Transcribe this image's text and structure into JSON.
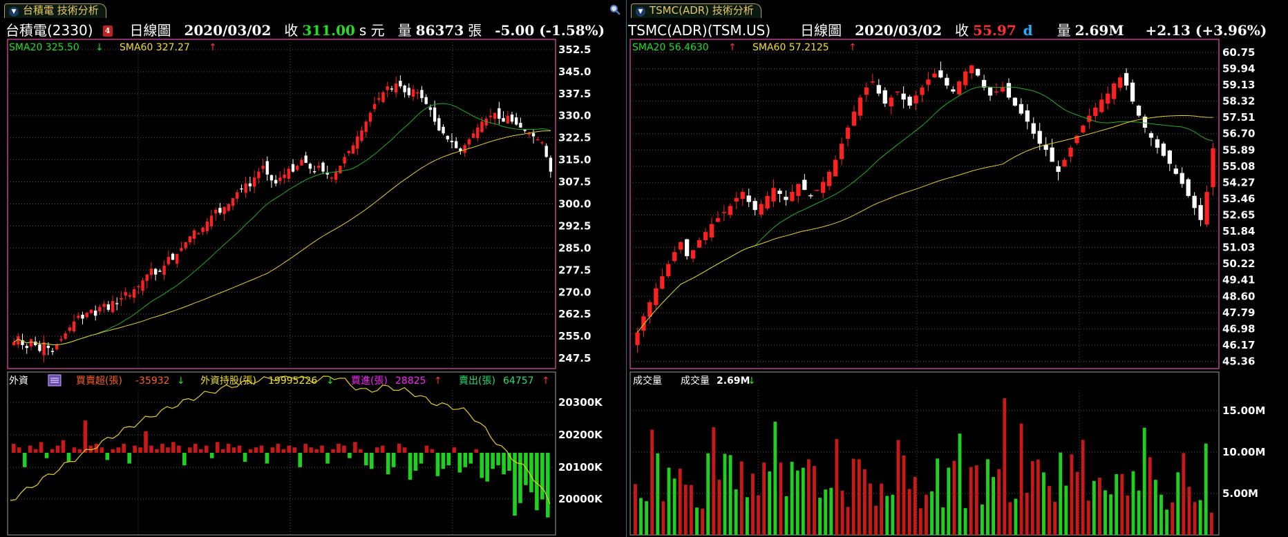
{
  "left": {
    "tab_label": "台積電 技術分析",
    "header": {
      "name": "台積電(2330)",
      "badge": "4",
      "period": "日線圖",
      "date": "2020/03/02",
      "close_label": "收",
      "close_value": "311.00",
      "close_unit": "s 元",
      "volume_label": "量",
      "volume_value": "86373",
      "volume_unit": "張",
      "change": "-5.00 (-1.58%)"
    },
    "legend": {
      "sma20": "SMA20 325.50",
      "sma20_dir": "↓",
      "sma60": "SMA60 327.27",
      "sma60_dir": "↑"
    },
    "y_ticks": [
      "352.5",
      "345.0",
      "337.5",
      "330.0",
      "322.5",
      "315.0",
      "307.5",
      "300.0",
      "292.5",
      "285.0",
      "277.5",
      "270.0",
      "262.5",
      "255.0",
      "247.5"
    ],
    "sub": {
      "title": "外資",
      "net_label": "買賣超(張)",
      "net_value": "-35932",
      "net_dir": "↓",
      "holding_label": "外資持股(張)",
      "holding_value": "19995226",
      "holding_dir": "↓",
      "buy_label": "買進(張)",
      "buy_value": "28825",
      "buy_dir": "↑",
      "sell_label": "賣出(張)",
      "sell_value": "64757",
      "sell_dir": "↑",
      "y_ticks": [
        "20300K",
        "20200K",
        "20100K",
        "20000K"
      ]
    }
  },
  "right": {
    "tab_label": "TSMC(ADR) 技術分析",
    "header": {
      "name": "TSMC(ADR)(TSM.US)",
      "period": "日線圖",
      "date": "2020/03/02",
      "close_label": "收",
      "close_value": "55.97",
      "close_unit": "d",
      "volume_label": "量",
      "volume_value": "2.69M",
      "change": "+2.13 (+3.96%)"
    },
    "legend": {
      "sma20": "SMA20 56.4630",
      "sma20_dir": "↑",
      "sma60": "SMA60 57.2125",
      "sma60_dir": "↑"
    },
    "y_ticks": [
      "60.75",
      "59.94",
      "59.13",
      "58.32",
      "57.51",
      "56.70",
      "55.89",
      "55.08",
      "54.27",
      "53.46",
      "52.65",
      "51.84",
      "51.03",
      "50.22",
      "49.41",
      "48.60",
      "47.79",
      "46.98",
      "46.17",
      "45.36"
    ],
    "sub": {
      "title": "成交量",
      "vol_label": "成交量",
      "vol_value": "2.69M",
      "vol_dir": "↓",
      "y_ticks": [
        "15.00M",
        "10.00M",
        "5.00M"
      ]
    }
  },
  "colors": {
    "up": "#ff2020",
    "down": "#ffffff",
    "vol_up": "#c81818",
    "vol_down": "#20d020",
    "sma20": "#20b020",
    "sma60": "#e8d020",
    "grid": "#555555",
    "frame_main": "#c0408a",
    "frame_sub": "#a0a0a0"
  },
  "chart_data": [
    {
      "type": "candlestick",
      "title": "台積電(2330) 日線圖",
      "ylim": [
        244,
        356
      ],
      "y_ticks": [
        352.5,
        345.0,
        337.5,
        330.0,
        322.5,
        315.0,
        307.5,
        300.0,
        292.5,
        285.0,
        277.5,
        270.0,
        262.5,
        255.0,
        247.5
      ],
      "start_price": 252,
      "closes": [
        253,
        255,
        252,
        251,
        254,
        252,
        250,
        253,
        251,
        250,
        252,
        254,
        256,
        258,
        260,
        262,
        261,
        263,
        264,
        262,
        265,
        266,
        264,
        267,
        266,
        268,
        270,
        269,
        271,
        272,
        274,
        276,
        278,
        276,
        277,
        279,
        282,
        281,
        283,
        285,
        287,
        289,
        291,
        290,
        292,
        294,
        296,
        298,
        297,
        299,
        300,
        302,
        304,
        305,
        307,
        306,
        309,
        311,
        313,
        310,
        308,
        307,
        309,
        310,
        312,
        311,
        313,
        315,
        314,
        312,
        311,
        313,
        311,
        310,
        309,
        311,
        313,
        316,
        318,
        320,
        323,
        325,
        328,
        331,
        334,
        336,
        338,
        340,
        339,
        341,
        340,
        338,
        337,
        339,
        338,
        336,
        334,
        332,
        328,
        325,
        324,
        322,
        321,
        319,
        318,
        320,
        322,
        324,
        326,
        328,
        329,
        330,
        331,
        329,
        328,
        330,
        328,
        327,
        326,
        325,
        324,
        323,
        322,
        321,
        316,
        311
      ],
      "sma20_end": 325.5,
      "sma60_end": 327.27
    },
    {
      "type": "bar",
      "title": "外資 買賣超(張)",
      "values": [
        5,
        3,
        -8,
        4,
        2,
        6,
        -3,
        2,
        4,
        7,
        -5,
        3,
        2,
        18,
        4,
        5,
        3,
        -4,
        2,
        3,
        5,
        -6,
        4,
        3,
        12,
        4,
        2,
        5,
        3,
        6,
        4,
        -7,
        3,
        5,
        2,
        4,
        -3,
        6,
        2,
        5,
        3,
        4,
        -5,
        2,
        3,
        4,
        -6,
        3,
        5,
        2,
        4,
        3,
        -8,
        5,
        3,
        2,
        4,
        -6,
        2,
        5,
        4,
        -3,
        6,
        2,
        -7,
        -9,
        3,
        4,
        -12,
        -8,
        5,
        3,
        -15,
        -10,
        -6,
        4,
        2,
        -13,
        -9,
        -7,
        3,
        -11,
        -8,
        -6,
        2,
        -14,
        -16,
        -9,
        -7,
        -12,
        -10,
        -35,
        -28,
        -18,
        -22,
        -32,
        -26,
        -36
      ],
      "line": {
        "name": "外資持股(張)",
        "ylim": [
          19970,
          20360
        ],
        "unit": "K"
      }
    },
    {
      "type": "candlestick",
      "title": "TSMC(ADR)(TSM.US) 日線圖",
      "ylim": [
        45.0,
        61.4
      ],
      "y_ticks": [
        60.75,
        59.94,
        59.13,
        58.32,
        57.51,
        56.7,
        55.89,
        55.08,
        54.27,
        53.46,
        52.65,
        51.84,
        51.03,
        50.22,
        49.41,
        48.6,
        47.79,
        46.98,
        46.17,
        45.36
      ],
      "sma20_end": 56.463,
      "sma60_end": 57.2125
    },
    {
      "type": "bar",
      "title": "成交量",
      "ylim": [
        0,
        17.5
      ],
      "y_ticks": [
        15.0,
        10.0,
        5.0
      ],
      "last_value": 2.69,
      "unit": "M"
    }
  ]
}
